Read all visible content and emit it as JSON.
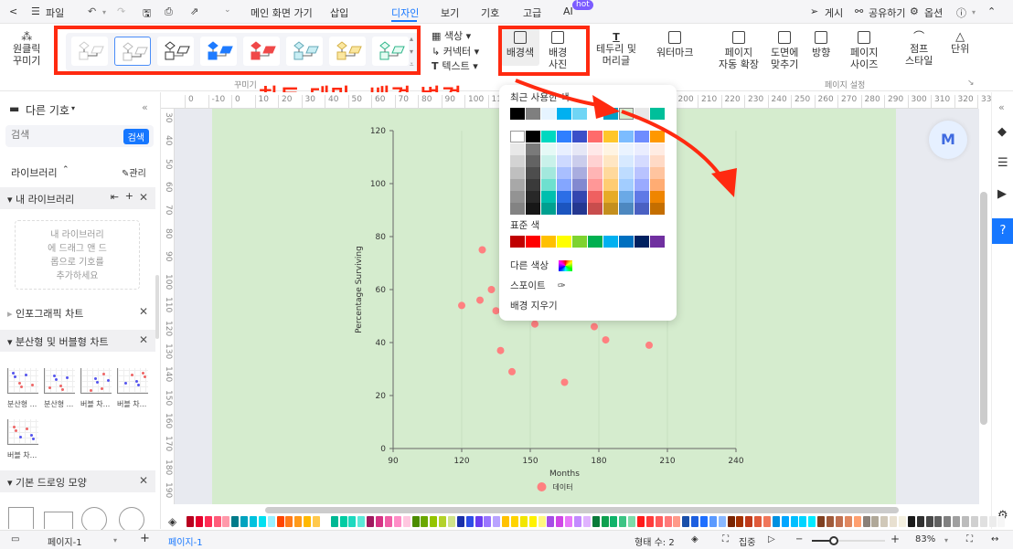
{
  "topbar": {
    "back": "<",
    "file": "파일",
    "tabs": [
      "메인 화면 가기",
      "삽입",
      "디자인",
      "보기",
      "기호",
      "고급",
      "AI"
    ],
    "active_tab": "디자인",
    "hot_badge": "hot",
    "publish": "게시",
    "share": "공유하기",
    "options": "옵션"
  },
  "ribbon": {
    "one_click_line1": "원클릭",
    "one_click_line2": "꾸미기",
    "color": "색상",
    "connector": "커넥터",
    "text": "텍스트",
    "bg_color": "배경색",
    "bg_image_line1": "배경",
    "bg_image_line2": "사진",
    "border_line1": "테두리 및",
    "border_line2": "머리글",
    "watermark": "워터마크",
    "auto_expand_line1": "페이지",
    "auto_expand_line2": "자동 확장",
    "fit_line1": "도면에",
    "fit_line2": "맞추기",
    "orientation": "방향",
    "page_size_line1": "페이지",
    "page_size_line2": "사이즈",
    "jump_line1": "점프",
    "jump_line2": "스타일",
    "unit": "단위",
    "group_decorate": "꾸미기",
    "group_page_setup": "페이지 설정"
  },
  "annotation": {
    "title": "차트 테마, 배경 변경",
    "color": "#ff2a10"
  },
  "left_panel": {
    "title": "다른 기호",
    "search_placeholder": "검색",
    "search_button": "검색",
    "library": "라이브러리",
    "manage": "관리",
    "my_library": "내 라이브러리",
    "drop_hint": [
      "내 라이브러리",
      "에 드래그 앤 드",
      "롭으로 기호를",
      "추가하세요"
    ],
    "sections": [
      "인포그래픽 차트",
      "분산형 및 버블형 차트",
      "기본 드로잉 모양"
    ],
    "thumbs": [
      "분산형 ...",
      "분산형 ...",
      "버블 차...",
      "버블 차...",
      "버블 차..."
    ]
  },
  "hruler_ticks": [
    "0",
    "-10",
    "0",
    "10",
    "20",
    "30",
    "40",
    "50",
    "60",
    "70",
    "80",
    "90",
    "100",
    "110",
    "120",
    "",
    "",
    "",
    "",
    "",
    "",
    "200",
    "210",
    "220",
    "230",
    "240",
    "250",
    "260",
    "270",
    "280",
    "290",
    "300",
    "310",
    "320",
    "33"
  ],
  "vruler_ticks": [
    "30",
    "40",
    "50",
    "60",
    "70",
    "80",
    "90",
    "100",
    "110",
    "120",
    "130",
    "140",
    "150",
    "160",
    "170",
    "180",
    "190"
  ],
  "color_popup": {
    "recent_label": "최근 사용한 색",
    "recent": [
      "#000000",
      "#7f7f7f",
      "#e6f4ff",
      "#00b0f0",
      "#6fd5f5",
      "#ffffff",
      "#00a0c6",
      "#d5ecce",
      "#e8e8e8",
      "#00bf9a"
    ],
    "theme_top": [
      "#ffffff",
      "#000000",
      "#00d8c0",
      "#2f7fff",
      "#3a4fc9",
      "#ff6b6b",
      "#ffc62a",
      "#7cbcff",
      "#6e8cff",
      "#ff9800"
    ],
    "theme_columns": [
      [
        "#e8e8e8",
        "#d3d3d3",
        "#bfbfbf",
        "#a8a8a8",
        "#939393",
        "#838383"
      ],
      [
        "#7a7a7a",
        "#636363",
        "#4d4d4d",
        "#3a3a3a",
        "#282828",
        "#171717"
      ],
      [
        "#e5f9f6",
        "#c9f1ea",
        "#a3e8dd",
        "#6ee0cf",
        "#00bfae",
        "#00a090"
      ],
      [
        "#e8efff",
        "#cdd9ff",
        "#a9bfff",
        "#84a6ff",
        "#2c6ee6",
        "#1c55bf"
      ],
      [
        "#e6e7f6",
        "#cbcdec",
        "#a9addf",
        "#8289d0",
        "#3346b0",
        "#243790"
      ],
      [
        "#ffe8e8",
        "#ffd2d2",
        "#ffb5b5",
        "#ff9797",
        "#ef6060",
        "#c84d4d"
      ],
      [
        "#fff4e2",
        "#ffe6c3",
        "#ffd99c",
        "#ffcc72",
        "#e6ab27",
        "#c48f1e"
      ],
      [
        "#eaf3ff",
        "#d7e9ff",
        "#bedcff",
        "#a2cdff",
        "#6aa9e6",
        "#4d88c0"
      ],
      [
        "#eaedff",
        "#d5dbff",
        "#b9c3ff",
        "#9aaaff",
        "#5f79e6",
        "#4a60c2"
      ],
      [
        "#ffece3",
        "#ffdac6",
        "#ffc49f",
        "#ffac73",
        "#ef8500",
        "#c46e00"
      ]
    ],
    "standard_label": "표준 색",
    "standard": [
      "#c00000",
      "#ff0000",
      "#ffc000",
      "#ffff00",
      "#7ed32f",
      "#00b050",
      "#00b0f0",
      "#0070c0",
      "#002060",
      "#7030a0"
    ],
    "more_colors": "다른 색상",
    "eyedropper": "스포이트",
    "clear_bg": "배경 지우기"
  },
  "chart_data": {
    "type": "scatter",
    "xlabel": "Months",
    "ylabel": "Percentage Surviving",
    "xlim": [
      90,
      240
    ],
    "ylim": [
      0,
      120
    ],
    "xticks": [
      90,
      120,
      150,
      180,
      210,
      240
    ],
    "yticks": [
      0,
      20,
      40,
      60,
      80,
      100,
      120
    ],
    "series": [
      {
        "name": "데이터",
        "color": "#ff8080",
        "points": [
          [
            120,
            54
          ],
          [
            128,
            56
          ],
          [
            129,
            75
          ],
          [
            133,
            60
          ],
          [
            135,
            52
          ],
          [
            137,
            37
          ],
          [
            142,
            29
          ],
          [
            152,
            47
          ],
          [
            165,
            25
          ],
          [
            178,
            46
          ],
          [
            183,
            41
          ],
          [
            202,
            39
          ]
        ]
      }
    ],
    "legend": "bottom",
    "background": "#d5ecce"
  },
  "palette_colors": [
    "#b8001f",
    "#e4002b",
    "#ff2d55",
    "#ff5c7a",
    "#ff99aa",
    "#007b8a",
    "#00a3bf",
    "#00c2de",
    "#00e0f0",
    "#99f0ff",
    "#ff4500",
    "#ff7a1a",
    "#ff9a1a",
    "#ffb800",
    "#ffc94d",
    "#ffffff",
    "#00b894",
    "#00cca3",
    "#1dd9bf",
    "#5ce8d8",
    "#a0185f",
    "#d63384",
    "#f05fa6",
    "#ff8dc7",
    "#ffc7e0",
    "#4c8c00",
    "#6aa800",
    "#94c400",
    "#b3d22a",
    "#cfe38a",
    "#1a2faa",
    "#2e4de6",
    "#6a3df0",
    "#9a75ff",
    "#b9a3ff",
    "#ffc200",
    "#ffd400",
    "#f2e600",
    "#fff200",
    "#fff780",
    "#a64de6",
    "#d046e6",
    "#e879f9",
    "#c389ff",
    "#e0b3ff",
    "#0a7a3a",
    "#0ea04f",
    "#10b36a",
    "#3cc484",
    "#7ddcaa",
    "#ff1a1a",
    "#ff3b3b",
    "#ff5c5c",
    "#ff7a7a",
    "#ff9a8a",
    "#1a4faa",
    "#1d5fe0",
    "#1e6fff",
    "#5b9aff",
    "#8ab8ff",
    "#7a2400",
    "#a33000",
    "#bf3a1a",
    "#e05a3a",
    "#f0765a",
    "#0090e0",
    "#00a6ff",
    "#00bfff",
    "#00d4ff",
    "#00eaff",
    "#804020",
    "#a05a3a",
    "#c07050",
    "#e08860",
    "#ffa070",
    "#8a8078",
    "#b0a898",
    "#d0c8b8",
    "#e8e0d0",
    "#f4f0e0",
    "#1a1a1a",
    "#303030",
    "#484848",
    "#606060",
    "#808080",
    "#a0a0a0",
    "#bcbcbc",
    "#d0d0d0",
    "#e0e0e0",
    "#ececec",
    "#f6f6f6"
  ],
  "status": {
    "page_select": "페이지-1",
    "page_tab": "페이지-1",
    "shape_count": "형태 수: 2",
    "focus": "집중",
    "zoom": "83%",
    "zoom_level": 0.3
  }
}
